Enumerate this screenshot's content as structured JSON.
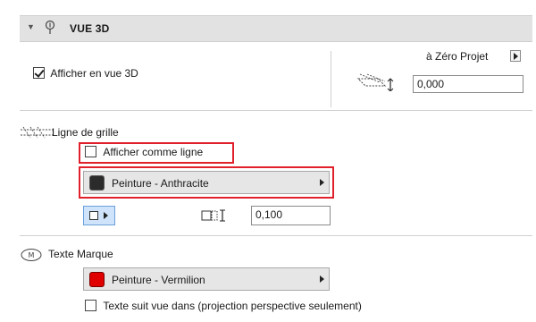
{
  "section": {
    "title": "VUE 3D",
    "collapse_icon": "chevron-down-icon",
    "header_icon": "grid-pin-icon"
  },
  "view3d": {
    "show_label": "Afficher en vue 3D",
    "show_checked": true,
    "reference_label": "à Zéro Projet",
    "elevation_value": "0,000"
  },
  "grid_line": {
    "heading": "Ligne de grille",
    "show_as_line_label": "Afficher comme ligne",
    "show_as_line_checked": false,
    "surface_label": "Peinture - Anthracite",
    "surface_color": "#2b2b2b",
    "thickness_value": "0,100"
  },
  "marker_text": {
    "heading": "Texte Marque",
    "surface_label": "Peinture - Vermilion",
    "surface_color": "#e00000",
    "follow_view_label": "Texte suit vue dans (projection perspective seulement)",
    "follow_view_checked": false
  },
  "colors": {
    "highlight": "#e0212b",
    "header_bg": "#e2e2e2"
  }
}
